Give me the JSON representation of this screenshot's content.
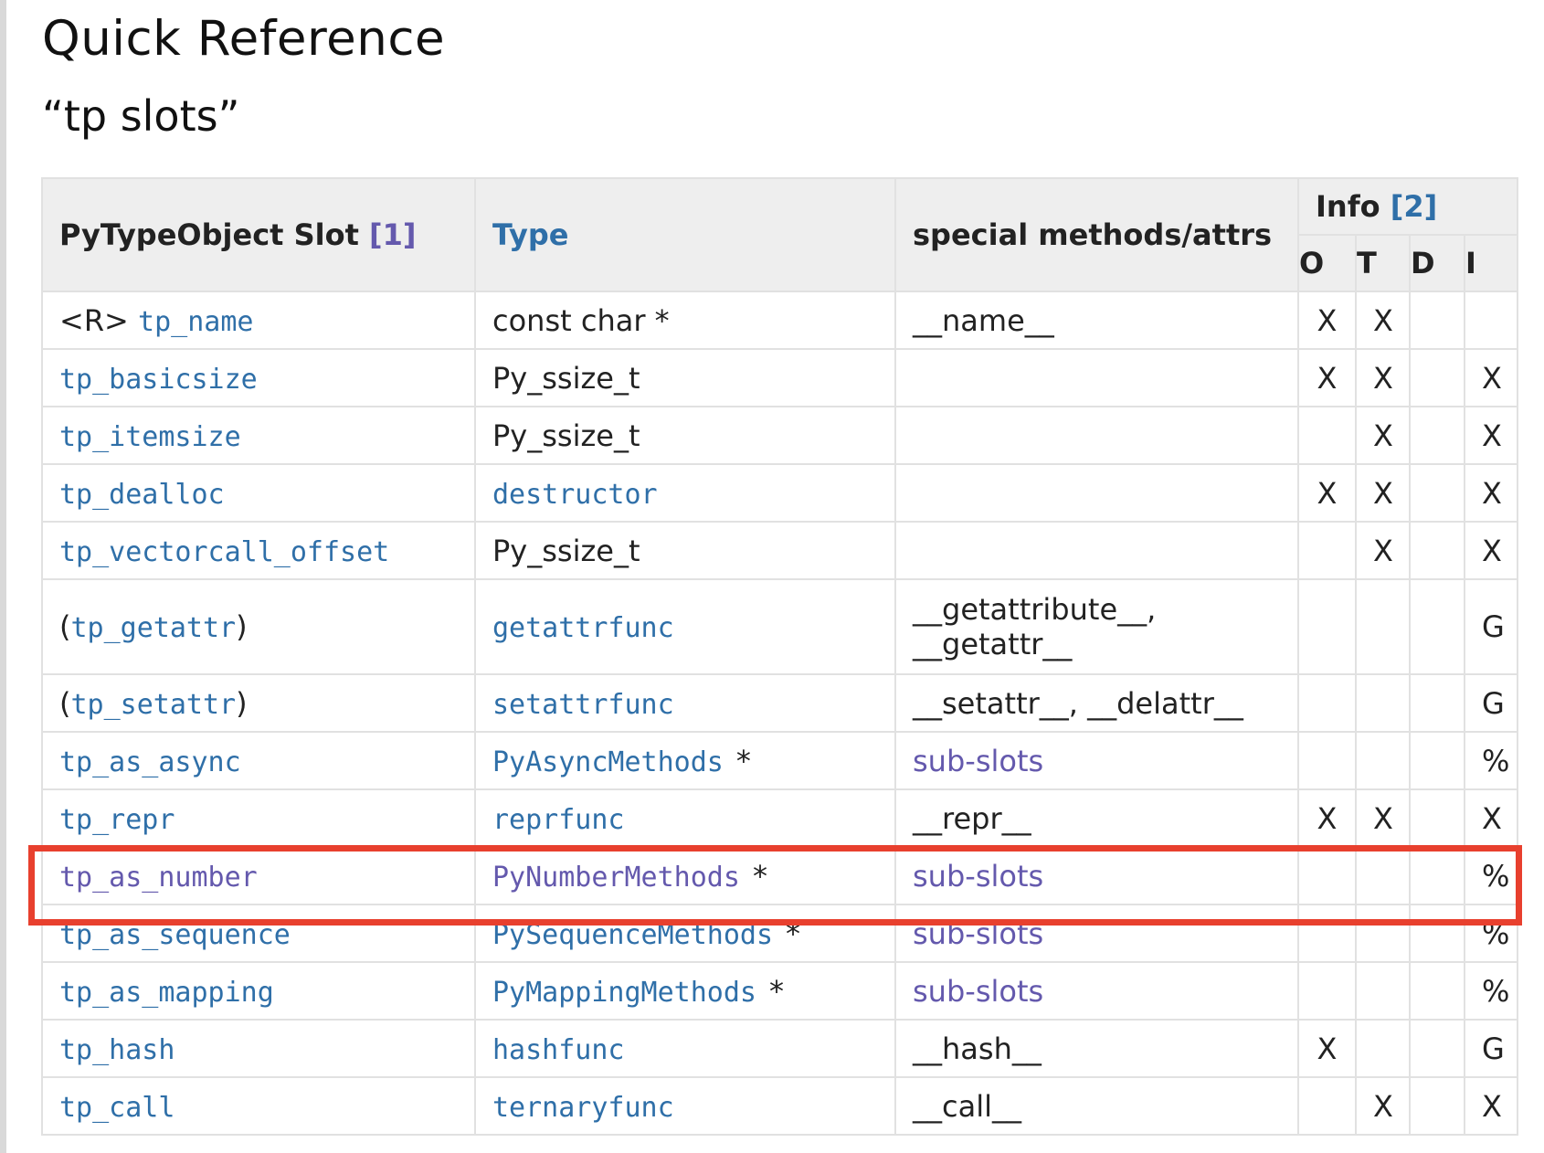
{
  "heading": "Quick Reference",
  "subheading": "“tp slots”",
  "table": {
    "col_slot": "PyTypeObject Slot",
    "col_slot_ref": "[1]",
    "col_type": "Type",
    "col_special": "special methods/attrs",
    "col_info": "Info",
    "col_info_ref": "[2]",
    "info_flags": [
      "O",
      "T",
      "D",
      "I"
    ],
    "rows": [
      {
        "pre": "<R> ",
        "slot": "tp_name",
        "post": "",
        "type": "const char *",
        "type_link": false,
        "star": "",
        "special": "__name__",
        "special_link": false,
        "flags": [
          "X",
          "X",
          "",
          ""
        ]
      },
      {
        "pre": "",
        "slot": "tp_basicsize",
        "post": "",
        "type": "Py_ssize_t",
        "type_link": false,
        "star": "",
        "special": "",
        "special_link": false,
        "flags": [
          "X",
          "X",
          "",
          "X"
        ]
      },
      {
        "pre": "",
        "slot": "tp_itemsize",
        "post": "",
        "type": "Py_ssize_t",
        "type_link": false,
        "star": "",
        "special": "",
        "special_link": false,
        "flags": [
          "",
          "X",
          "",
          "X"
        ]
      },
      {
        "pre": "",
        "slot": "tp_dealloc",
        "post": "",
        "type": "destructor",
        "type_link": true,
        "star": "",
        "special": "",
        "special_link": false,
        "flags": [
          "X",
          "X",
          "",
          "X"
        ]
      },
      {
        "pre": "",
        "slot": "tp_vectorcall_offset",
        "post": "",
        "type": "Py_ssize_t",
        "type_link": false,
        "star": "",
        "special": "",
        "special_link": false,
        "flags": [
          "",
          "X",
          "",
          "X"
        ]
      },
      {
        "pre": "(",
        "slot": "tp_getattr",
        "post": ")",
        "type": "getattrfunc",
        "type_link": true,
        "star": "",
        "special": "__getattribute__,",
        "special2": "__getattr__",
        "special_link": false,
        "flags": [
          "",
          "",
          "",
          "G"
        ]
      },
      {
        "pre": "(",
        "slot": "tp_setattr",
        "post": ")",
        "type": "setattrfunc",
        "type_link": true,
        "star": "",
        "special": "__setattr__, __delattr__",
        "special_link": false,
        "flags": [
          "",
          "",
          "",
          "G"
        ]
      },
      {
        "pre": "",
        "slot": "tp_as_async",
        "post": "",
        "type": "PyAsyncMethods",
        "type_link": true,
        "star": "*",
        "special": "sub-slots",
        "special_link": true,
        "flags": [
          "",
          "",
          "",
          "%"
        ]
      },
      {
        "pre": "",
        "slot": "tp_repr",
        "post": "",
        "type": "reprfunc",
        "type_link": true,
        "star": "",
        "special": "__repr__",
        "special_link": false,
        "flags": [
          "X",
          "X",
          "",
          "X"
        ]
      },
      {
        "pre": "",
        "slot": "tp_as_number",
        "post": "",
        "type": "PyNumberMethods",
        "type_link": true,
        "star": "*",
        "special": "sub-slots",
        "special_link": true,
        "flags": [
          "",
          "",
          "",
          "%"
        ]
      },
      {
        "pre": "",
        "slot": "tp_as_sequence",
        "post": "",
        "type": "PySequenceMethods",
        "type_link": true,
        "star": "*",
        "special": "sub-slots",
        "special_link": true,
        "flags": [
          "",
          "",
          "",
          "%"
        ]
      },
      {
        "pre": "",
        "slot": "tp_as_mapping",
        "post": "",
        "type": "PyMappingMethods",
        "type_link": true,
        "star": "*",
        "special": "sub-slots",
        "special_link": true,
        "flags": [
          "",
          "",
          "",
          "%"
        ]
      },
      {
        "pre": "",
        "slot": "tp_hash",
        "post": "",
        "type": "hashfunc",
        "type_link": true,
        "star": "",
        "special": "__hash__",
        "special_link": false,
        "flags": [
          "X",
          "",
          "",
          "G"
        ]
      },
      {
        "pre": "",
        "slot": "tp_call",
        "post": "",
        "type": "ternaryfunc",
        "type_link": true,
        "star": "",
        "special": "__call__",
        "special_link": false,
        "flags": [
          "",
          "X",
          "",
          "X"
        ]
      }
    ]
  },
  "highlight": {
    "row": "tp_as_number",
    "color": "#e8402e"
  },
  "colors": {
    "link": "#2f6fa8",
    "visited_link": "#6459ad",
    "header_bg": "#eeeeee",
    "border": "#e1e1e1"
  }
}
